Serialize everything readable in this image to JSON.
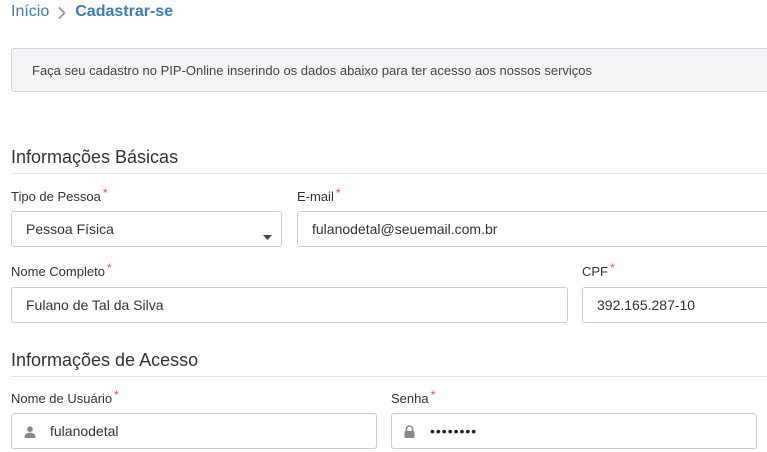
{
  "breadcrumb": {
    "home": "Início",
    "current": "Cadastrar-se"
  },
  "alert": {
    "text": "Faça seu cadastro no PIP-Online inserindo os dados abaixo para ter acesso aos nossos serviços"
  },
  "sections": {
    "basic": "Informações Básicas",
    "access": "Informações de Acesso"
  },
  "form": {
    "person_type": {
      "label": "Tipo de Pessoa",
      "value": "Pessoa Física"
    },
    "email": {
      "label": "E-mail",
      "value": "fulanodetal@seuemail.com.br"
    },
    "full_name": {
      "label": "Nome Completo",
      "value": "Fulano de Tal da Silva"
    },
    "cpf": {
      "label": "CPF",
      "value": "392.165.287-10"
    },
    "username": {
      "label": "Nome de Usuário",
      "value": "fulanodetal"
    },
    "password": {
      "label": "Senha",
      "value": "••••••••"
    },
    "required_mark": "*"
  },
  "icons": {
    "breadcrumb_separator": "chevron-right-icon",
    "select_caret": "caret-down-icon",
    "username": "user-icon",
    "password": "lock-icon"
  },
  "colors": {
    "link": "#3b7bbf",
    "required": "#d9534f",
    "alert_bg": "#f3f4f6"
  }
}
